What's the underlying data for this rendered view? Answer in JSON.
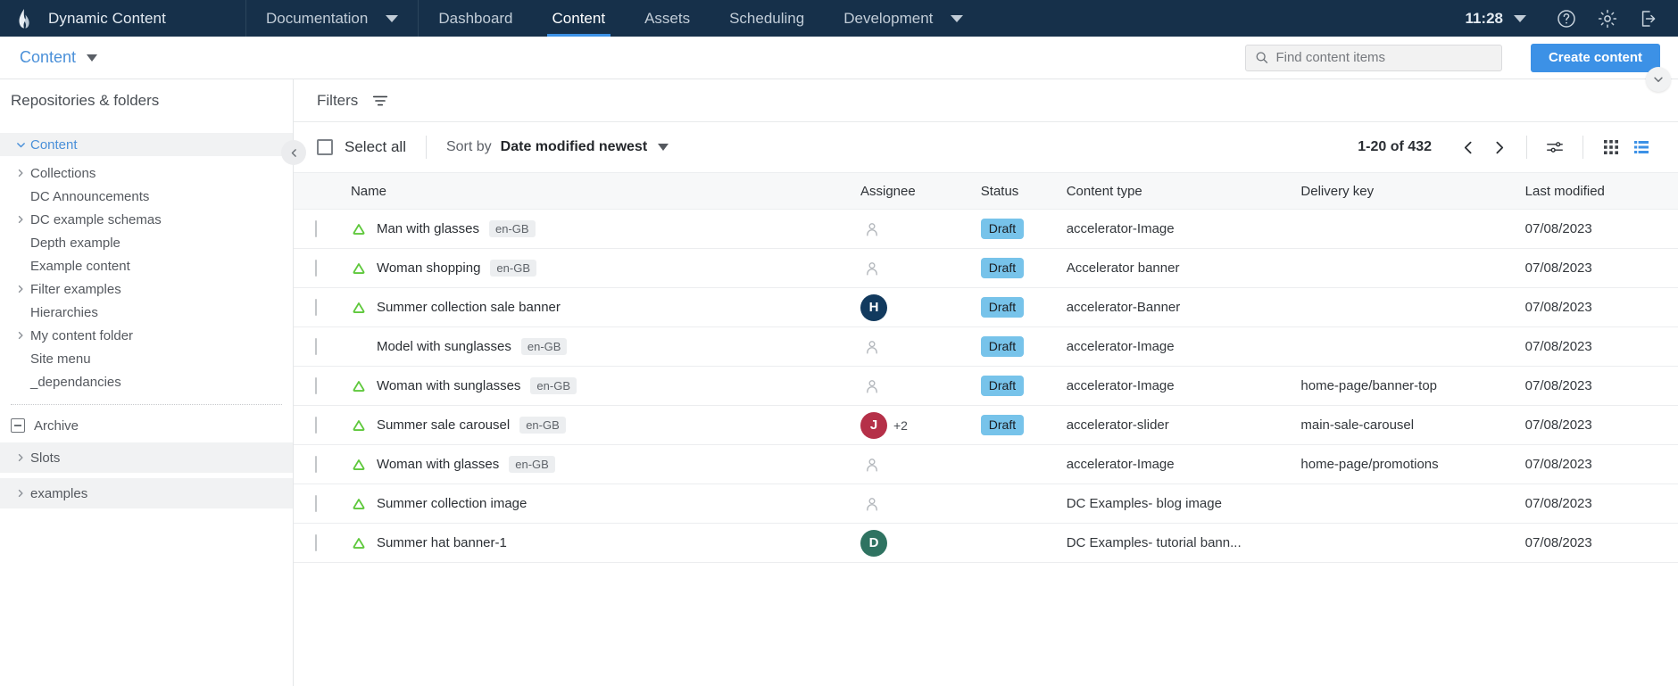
{
  "topnav": {
    "brand": "Dynamic Content",
    "items": [
      {
        "label": "Documentation",
        "dropdown": true,
        "active": false
      },
      {
        "label": "Dashboard",
        "dropdown": false,
        "active": false
      },
      {
        "label": "Content",
        "dropdown": false,
        "active": true
      },
      {
        "label": "Assets",
        "dropdown": false,
        "active": false
      },
      {
        "label": "Scheduling",
        "dropdown": false,
        "active": false
      },
      {
        "label": "Development",
        "dropdown": true,
        "active": false
      }
    ],
    "clock": "11:28",
    "icons": [
      "help-icon",
      "gear-icon",
      "logout-icon"
    ]
  },
  "subbar": {
    "breadcrumb": "Content",
    "search_placeholder": "Find content items",
    "search_value": "",
    "create_label": "Create content"
  },
  "sidebar": {
    "title": "Repositories & folders",
    "tree": [
      {
        "label": "Content",
        "level": 0,
        "twisty": "down",
        "selected": true,
        "accent": true
      },
      {
        "label": "Collections",
        "level": 1,
        "twisty": "right",
        "selected": false,
        "accent": false
      },
      {
        "label": "DC Announcements",
        "level": 1,
        "twisty": "none",
        "selected": false,
        "accent": false
      },
      {
        "label": "DC example schemas",
        "level": 1,
        "twisty": "right",
        "selected": false,
        "accent": false
      },
      {
        "label": "Depth example",
        "level": 1,
        "twisty": "none",
        "selected": false,
        "accent": false
      },
      {
        "label": "Example content",
        "level": 1,
        "twisty": "none",
        "selected": false,
        "accent": false
      },
      {
        "label": "Filter examples",
        "level": 1,
        "twisty": "right",
        "selected": false,
        "accent": false
      },
      {
        "label": "Hierarchies",
        "level": 1,
        "twisty": "none",
        "selected": false,
        "accent": false
      },
      {
        "label": "My content folder",
        "level": 1,
        "twisty": "right",
        "selected": false,
        "accent": false
      },
      {
        "label": "Site menu",
        "level": 1,
        "twisty": "none",
        "selected": false,
        "accent": false
      },
      {
        "label": "_dependancies",
        "level": 1,
        "twisty": "none",
        "selected": false,
        "accent": false
      }
    ],
    "archive": "Archive",
    "bottom": [
      {
        "label": "Slots",
        "twisty": "right"
      },
      {
        "label": "examples",
        "twisty": "right"
      }
    ]
  },
  "filters": {
    "label": "Filters"
  },
  "toolbar": {
    "select_all": "Select all",
    "sort_by_label": "Sort by",
    "sort_value": "Date modified newest",
    "page_range": "1-20 of 432"
  },
  "table": {
    "columns": [
      "Name",
      "Assignee",
      "Status",
      "Content type",
      "Delivery key",
      "Last modified"
    ],
    "rows": [
      {
        "name": "Man with glasses",
        "locale": "en-GB",
        "cloud": true,
        "avatar": null,
        "extra": "",
        "status": "Draft",
        "type": "accelerator-Image",
        "key": "",
        "modified": "07/08/2023"
      },
      {
        "name": "Woman shopping",
        "locale": "en-GB",
        "cloud": true,
        "avatar": null,
        "extra": "",
        "status": "Draft",
        "type": "Accelerator banner",
        "key": "",
        "modified": "07/08/2023"
      },
      {
        "name": "Summer collection sale banner",
        "locale": "",
        "cloud": true,
        "avatar": {
          "initial": "H",
          "color": "#123a5e"
        },
        "extra": "",
        "status": "Draft",
        "type": "accelerator-Banner",
        "key": "",
        "modified": "07/08/2023"
      },
      {
        "name": "Model with sunglasses",
        "locale": "en-GB",
        "cloud": false,
        "avatar": null,
        "extra": "",
        "status": "Draft",
        "type": "accelerator-Image",
        "key": "",
        "modified": "07/08/2023"
      },
      {
        "name": "Woman with sunglasses",
        "locale": "en-GB",
        "cloud": true,
        "avatar": null,
        "extra": "",
        "status": "Draft",
        "type": "accelerator-Image",
        "key": "home-page/banner-top",
        "modified": "07/08/2023"
      },
      {
        "name": "Summer sale carousel",
        "locale": "en-GB",
        "cloud": true,
        "avatar": {
          "initial": "J",
          "color": "#b53048"
        },
        "extra": "+2",
        "status": "Draft",
        "type": "accelerator-slider",
        "key": "main-sale-carousel",
        "modified": "07/08/2023"
      },
      {
        "name": "Woman with glasses",
        "locale": "en-GB",
        "cloud": true,
        "avatar": null,
        "extra": "",
        "status": "",
        "type": "accelerator-Image",
        "key": "home-page/promotions",
        "modified": "07/08/2023"
      },
      {
        "name": "Summer collection image",
        "locale": "",
        "cloud": true,
        "avatar": null,
        "extra": "",
        "status": "",
        "type": "DC Examples- blog image",
        "key": "",
        "modified": "07/08/2023"
      },
      {
        "name": "Summer hat banner-1",
        "locale": "",
        "cloud": true,
        "avatar": {
          "initial": "D",
          "color": "#2f7361"
        },
        "extra": "",
        "status": "",
        "type": "DC Examples- tutorial bann...",
        "key": "",
        "modified": "07/08/2023"
      }
    ]
  },
  "colors": {
    "nav_bg": "#16304a",
    "accent_blue": "#3c91e6",
    "link_blue": "#4a90d9",
    "cloud_green": "#5ec83b",
    "draft_badge": "#77c3ea"
  }
}
